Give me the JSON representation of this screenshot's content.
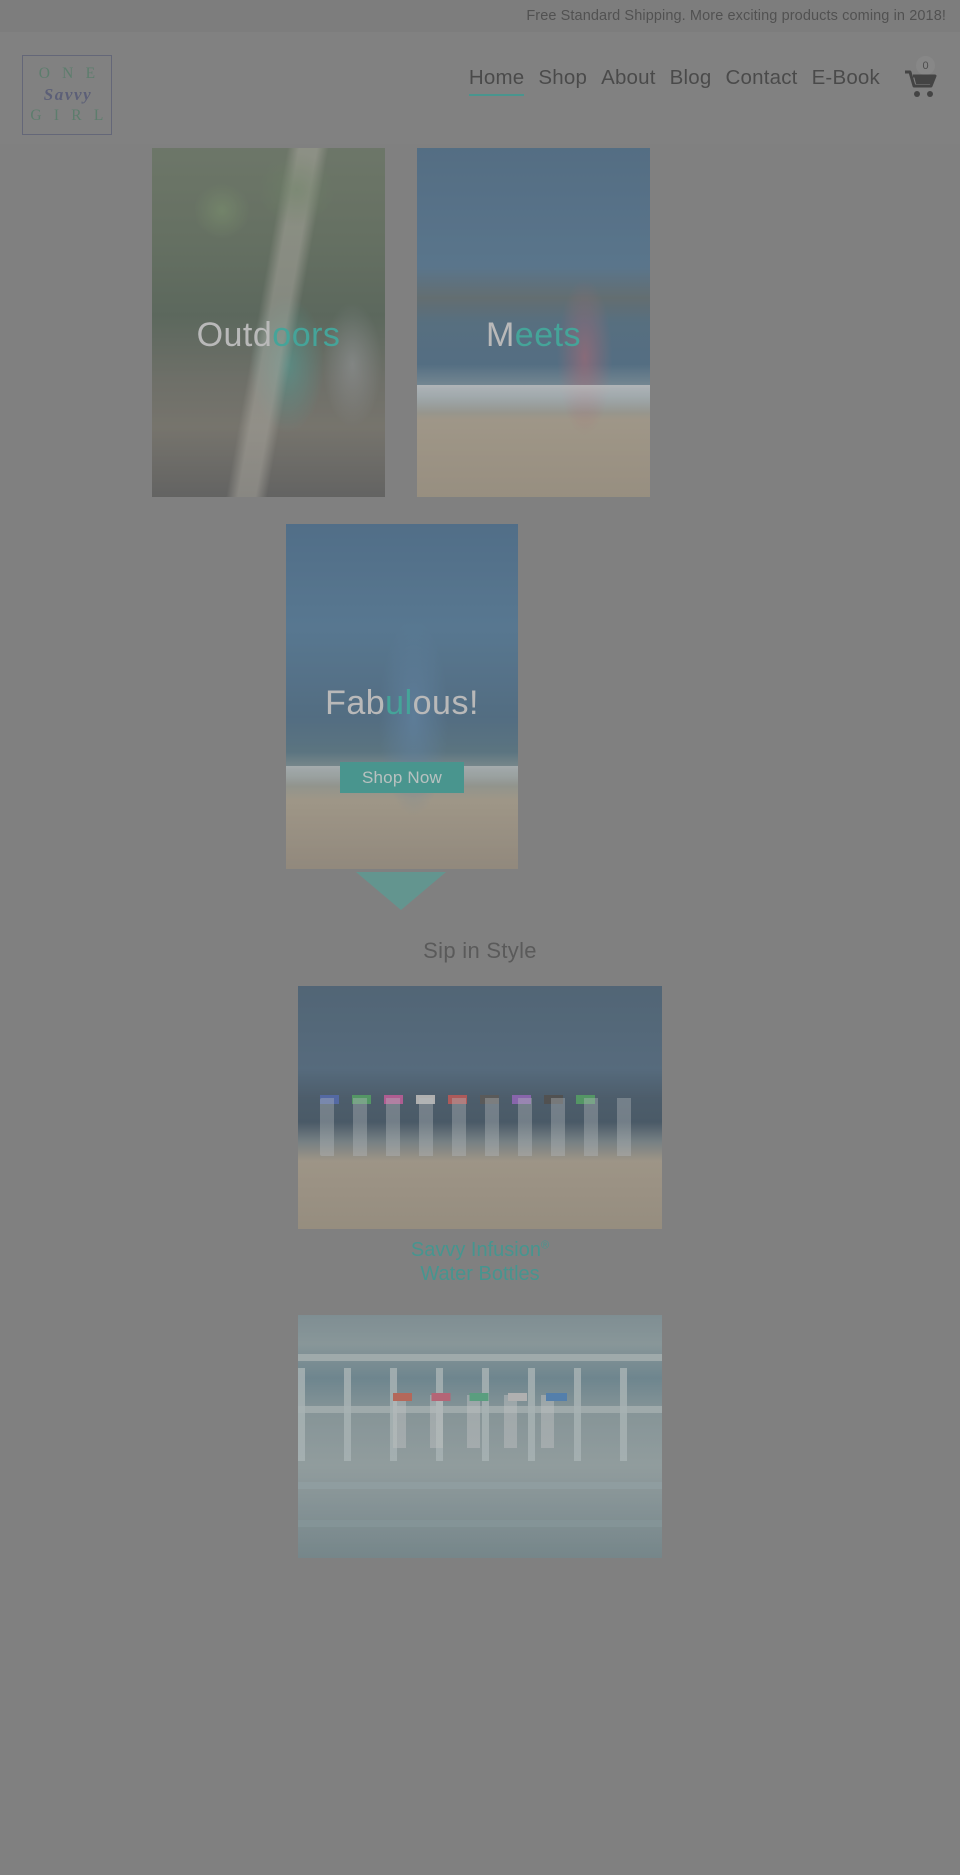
{
  "announcement": {
    "text": "Free Standard Shipping.  More exciting products coming in 2018!"
  },
  "logo": {
    "line1": "O N E",
    "line2": "Savvy",
    "line3": "G I R L"
  },
  "nav": {
    "items": [
      {
        "label": "Home",
        "active": true
      },
      {
        "label": "Shop",
        "active": false
      },
      {
        "label": "About",
        "active": false
      },
      {
        "label": "Blog",
        "active": false
      },
      {
        "label": "Contact",
        "active": false
      },
      {
        "label": "E-Book",
        "active": false
      }
    ],
    "cart": {
      "icon": "shopping-cart-icon",
      "count": "0"
    }
  },
  "hero": {
    "tiles": [
      {
        "label_white": "Outd",
        "label_teal": "oors",
        "alt": "two women jogging outdoors with infusion bottles"
      },
      {
        "label_white": "M",
        "label_teal": "eets",
        "alt": "woman drinking from infusion bottle on the beach"
      }
    ],
    "feature": {
      "label_white": "Fab",
      "label_teal": "ul",
      "label_white2": "ous!",
      "alt": "woman in blue top holding infusion water bottle at the beach",
      "cta": "Shop Now"
    }
  },
  "section": {
    "title": "Sip in Style",
    "arrow": "down-triangle-icon"
  },
  "products": [
    {
      "alt": "row of colorful Savvy Infusion water bottles on the sand",
      "caption_line1": "Savvy Infusion",
      "caption_sup": "®",
      "caption_line2": "Water Bottles"
    },
    {
      "alt": "Savvy Infusion water bottles lined up on a weathered beach railing",
      "caption_line1": "",
      "caption_sup": "",
      "caption_line2": ""
    }
  ],
  "colors": {
    "teal": "#1aa79a",
    "teal_text": "#13c2ae",
    "logo_green": "#3f7a5d",
    "logo_blue": "#3d4470",
    "page_bg": "#808080"
  }
}
